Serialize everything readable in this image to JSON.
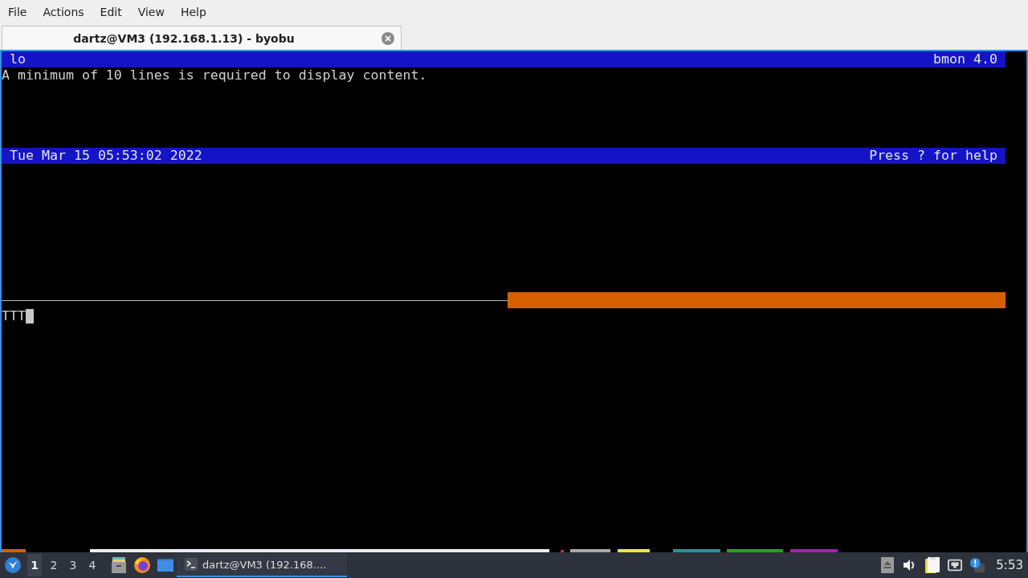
{
  "menu_bar": [
    "File",
    "Actions",
    "Edit",
    "View",
    "Help"
  ],
  "tabs": [
    {
      "title": "dartz@VM3 (192.168.1.13) - byobu",
      "selected": true
    }
  ],
  "bmon": {
    "header": {
      "left": "lo",
      "right": "bmon 4.0"
    },
    "message": "A minimum of 10 lines is required to display content.",
    "footer": {
      "left": "Tue Mar 15 05:53:02 2022",
      "right": "Press ? for help"
    }
  },
  "shell": {
    "input": "TTT"
  },
  "taskbar": {
    "workspaces": [
      {
        "label": "1",
        "selected": true
      },
      {
        "label": "2",
        "selected": false
      },
      {
        "label": "3",
        "selected": false
      },
      {
        "label": "4",
        "selected": false
      }
    ],
    "tasks": [
      {
        "title": "dartz@VM3 (192.168....",
        "selected": true
      }
    ],
    "clock": "5:53"
  }
}
